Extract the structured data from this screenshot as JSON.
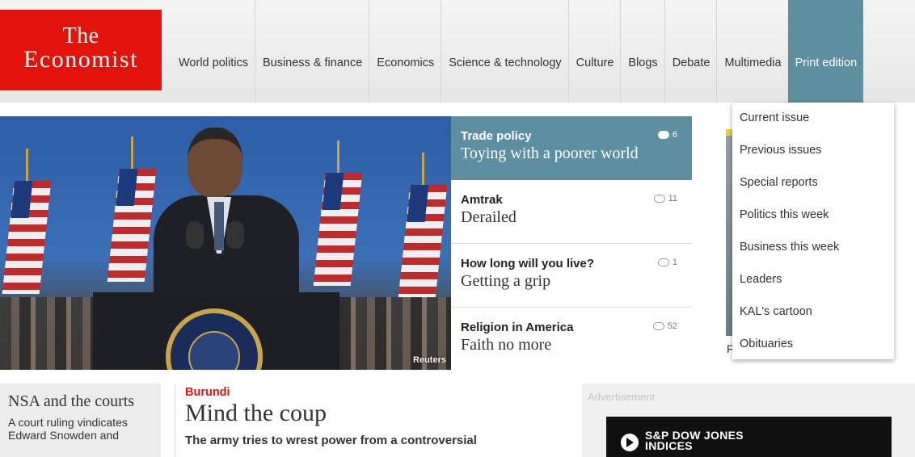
{
  "logo": {
    "line1": "The",
    "line2": "Economist"
  },
  "nav": [
    {
      "label": "World politics"
    },
    {
      "label": "Business & finance"
    },
    {
      "label": "Economics"
    },
    {
      "label": "Science & technology"
    },
    {
      "label": "Culture"
    },
    {
      "label": "Blogs"
    },
    {
      "label": "Debate"
    },
    {
      "label": "Multimedia"
    },
    {
      "label": "Print edition",
      "active": true
    }
  ],
  "dropdown": [
    {
      "label": "Current issue"
    },
    {
      "label": "Previous issues"
    },
    {
      "label": "Special reports"
    },
    {
      "label": "Politics this week"
    },
    {
      "label": "Business this week"
    },
    {
      "label": "Leaders"
    },
    {
      "label": "KAL's cartoon"
    },
    {
      "label": "Obituaries"
    }
  ],
  "hero": {
    "credit": "Reuters"
  },
  "stories": [
    {
      "kicker": "Trade policy",
      "headline": "Toying with a poorer world",
      "comments": "6"
    },
    {
      "kicker": "Amtrak",
      "headline": "Derailed",
      "comments": "11"
    },
    {
      "kicker": "How long will you live?",
      "headline": "Getting a grip",
      "comments": "1"
    },
    {
      "kicker": "Religion in America",
      "headline": "Faith no more",
      "comments": "52"
    }
  ],
  "side_panel": {
    "visible_letter": "F"
  },
  "nsa": {
    "title": "NSA and the courts",
    "desc": "A court ruling vindicates Edward Snowden and"
  },
  "main_story": {
    "kicker": "Burundi",
    "headline": "Mind the coup",
    "standfirst": "The army tries to wrest power from a controversial"
  },
  "ad": {
    "label": "Advertisement",
    "brand_line1": "S&P DOW JONES",
    "brand_line2": "INDICES"
  },
  "colors": {
    "brand_red": "#e3120b",
    "accent_teal": "#5d8fa0"
  }
}
